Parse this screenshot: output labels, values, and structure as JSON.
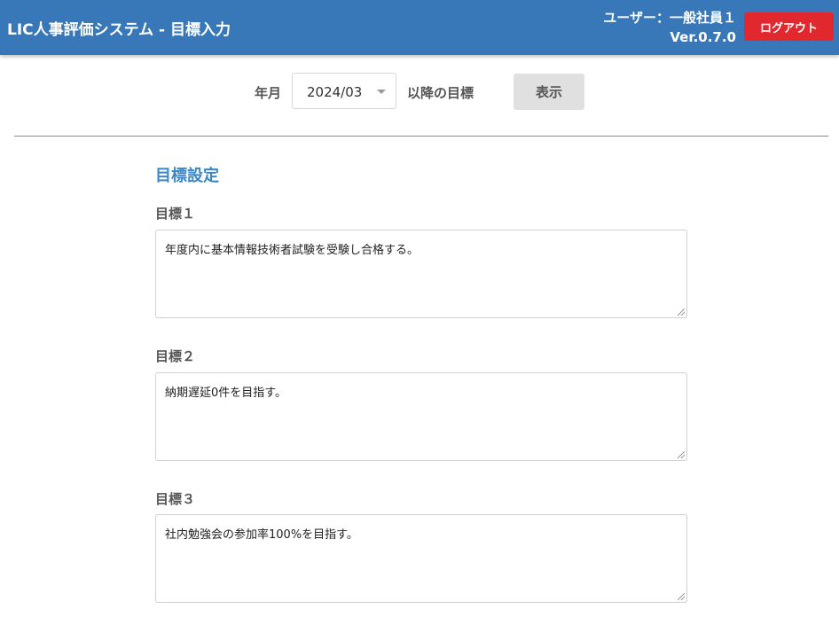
{
  "header": {
    "app_title": "LIC人事評価システム ‐ 目標入力",
    "user_label": "ユーザー：一般社員１",
    "version": "Ver.0.7.0",
    "logout_label": "ログアウト",
    "bg_color": "#3878b8",
    "logout_color": "#e0282e"
  },
  "filter": {
    "year_month_label": "年月",
    "year_month_value": "2024/03",
    "after_label": "以降の目標",
    "show_button_label": "表示"
  },
  "goals_section": {
    "title": "目標設定",
    "goals": [
      {
        "label": "目標１",
        "value": "年度内に基本情報技術者試験を受験し合格する。"
      },
      {
        "label": "目標２",
        "value": "納期遅延0件を目指す。"
      },
      {
        "label": "目標３",
        "value": "社内勉強会の参加率100%を目指す。"
      }
    ]
  }
}
